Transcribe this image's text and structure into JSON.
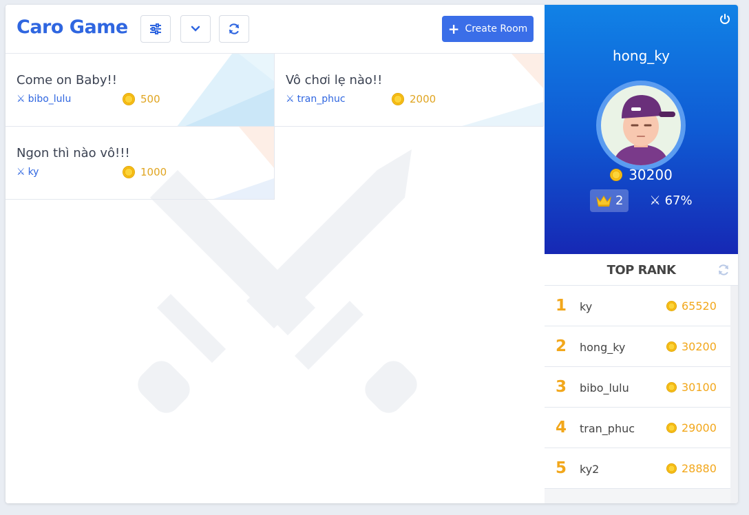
{
  "header": {
    "title": "Caro Game",
    "create_label": "Create Room"
  },
  "rooms": [
    {
      "name": "Come on Baby!!",
      "owner": "bibo_lulu",
      "bet": "500"
    },
    {
      "name": "Vô chơi lẹ nào!!",
      "owner": "tran_phuc",
      "bet": "2000"
    },
    {
      "name": "Ngon thì nào vô!!!",
      "owner": "ky",
      "bet": "1000"
    }
  ],
  "profile": {
    "username": "hong_ky",
    "balance": "30200",
    "rank": "2",
    "winrate": "67%"
  },
  "top_rank": {
    "title": "TOP RANK",
    "entries": [
      {
        "pos": "1",
        "name": "ky",
        "score": "65520"
      },
      {
        "pos": "2",
        "name": "hong_ky",
        "score": "30200"
      },
      {
        "pos": "3",
        "name": "bibo_lulu",
        "score": "30100"
      },
      {
        "pos": "4",
        "name": "tran_phuc",
        "score": "29000"
      },
      {
        "pos": "5",
        "name": "ky2",
        "score": "28880"
      }
    ]
  },
  "colors": {
    "brand": "#2f66e0",
    "button": "#3a6ee8",
    "gold": "#f2a71b",
    "profile_top": "#1182e6",
    "profile_bottom": "#1628b4"
  }
}
